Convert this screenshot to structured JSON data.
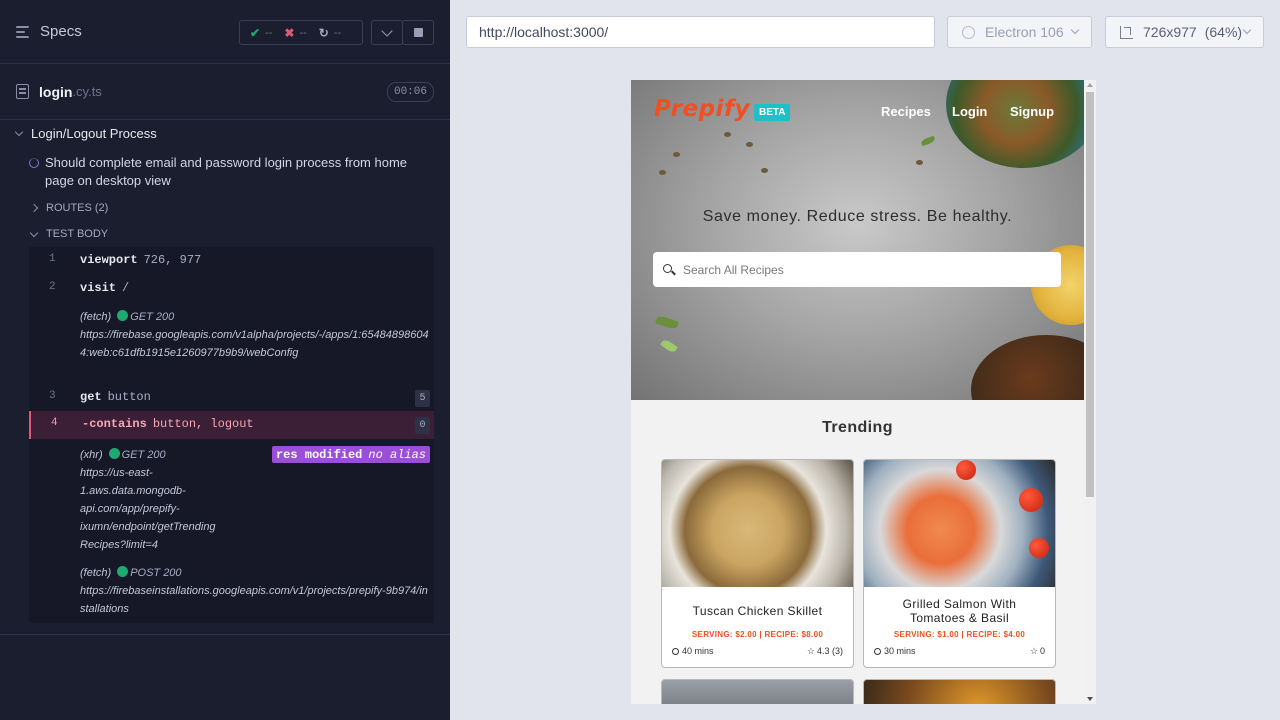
{
  "reporter": {
    "specs_label": "Specs",
    "stats": {
      "passed": "--",
      "failed": "--",
      "pending": "--",
      "pass_glyph": "✔",
      "fail_glyph": "✖",
      "pending_glyph": "↻"
    },
    "file": {
      "name": "login",
      "ext": ".cy.ts",
      "duration": "00:06"
    },
    "suite_title": "Login/Logout Process",
    "test_title": "Should complete email and password login process from home page on desktop view",
    "routes_label": "ROUTES (2)",
    "test_body_label": "TEST BODY",
    "commands": [
      {
        "num": "1",
        "name": "viewport",
        "message": "726, 977"
      },
      {
        "num": "2",
        "name": "visit",
        "message": "/"
      },
      {
        "num": "3",
        "name": "get",
        "message": "button",
        "count": "5"
      },
      {
        "num": "4",
        "name": "-contains",
        "message": "button, logout",
        "count": "0"
      }
    ],
    "logs": [
      {
        "type": "(fetch)",
        "method": "GET 200",
        "url": "https://firebase.googleapis.com/v1alpha/projects/-/apps/1:654848986044:web:c61dfb1915e1260977b9b9/webConfig"
      },
      {
        "type": "(xhr)",
        "method": "GET 200",
        "url_lines": [
          "https://us-east-",
          "1.aws.data.mongodb-",
          "api.com/app/prepify-",
          "ixumn/endpoint/getTrending",
          "Recipes?limit=4"
        ],
        "badge": "res modified",
        "badge_alias": "no alias"
      },
      {
        "type": "(fetch)",
        "method": "POST 200",
        "url": "https://firebaseinstallations.googleapis.com/v1/projects/prepify-9b974/installations"
      }
    ]
  },
  "browser": {
    "url": "http://localhost:3000/",
    "browser_name": "Electron 106",
    "viewport": "726x977",
    "scale": "(64%)"
  },
  "app": {
    "logo": "Prepify",
    "beta": "BETA",
    "nav": [
      "Recipes",
      "Login",
      "Signup"
    ],
    "tagline": "Save money. Reduce stress. Be healthy.",
    "search_placeholder": "Search All Recipes",
    "trending_title": "Trending",
    "recipes": [
      {
        "title": "Tuscan Chicken Skillet",
        "price": "SERVING: $2.00 | RECIPE: $8.00",
        "time": "40 mins",
        "rating": "4.3 (3)"
      },
      {
        "title": "Grilled Salmon With Tomatoes & Basil",
        "title_lines": [
          "Grilled Salmon With",
          "Tomatoes & Basil"
        ],
        "price": "SERVING: $1.00 | RECIPE: $4.00",
        "time": "30 mins",
        "rating": "0"
      }
    ]
  },
  "colors": {
    "reporter_bg": "#1b1e2e",
    "brand": "#f04e23",
    "beta": "#1ec0c8",
    "pass": "#1fa971",
    "fail": "#e45770",
    "badge": "#9b4fd6"
  }
}
